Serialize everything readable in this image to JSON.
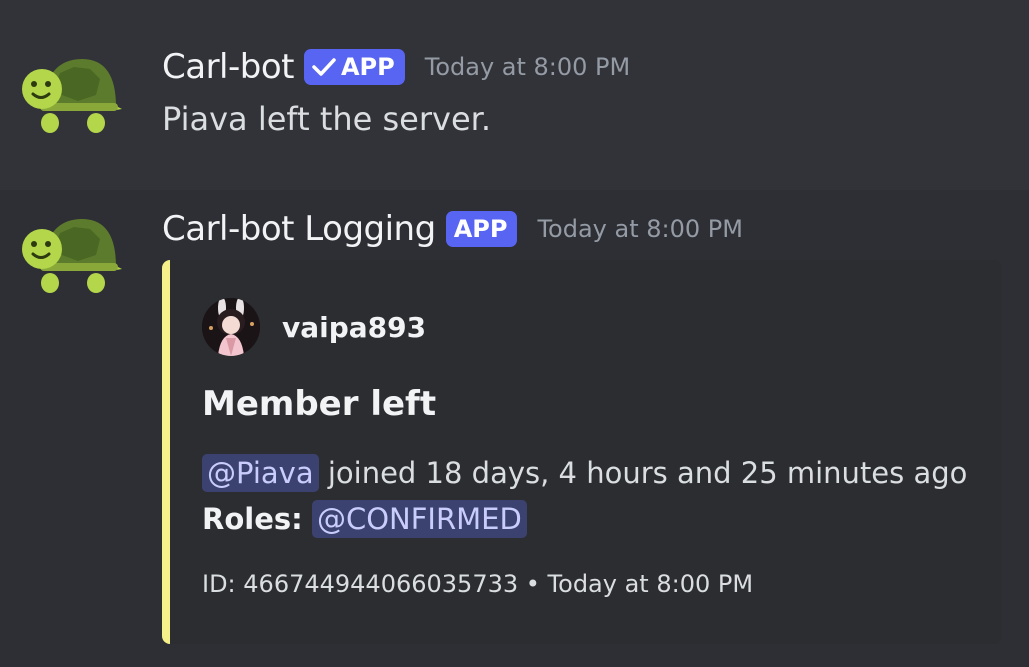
{
  "messages": [
    {
      "author": "Carl-bot",
      "badge": "APP",
      "verified": true,
      "timestamp": "Today at 8:00 PM",
      "content": "Piava left the server.",
      "avatar_icon": "turtle-icon"
    },
    {
      "author": "Carl-bot Logging",
      "badge": "APP",
      "verified": false,
      "timestamp": "Today at 8:00 PM",
      "avatar_icon": "turtle-icon",
      "embed": {
        "accent_color": "#f5f08a",
        "author_name": "vaipa893",
        "title": "Member left",
        "mention": "@Piava",
        "description_text": " joined 18 days, 4 hours and 25 minutes ago",
        "roles_label": "Roles:",
        "role_mention": "@CONFIRMED",
        "footer_id": "ID: 466744944066035733",
        "footer_separator": " • ",
        "footer_time": "Today at 8:00 PM"
      }
    }
  ],
  "colors": {
    "background": "#323339",
    "badge": "#5865f2",
    "mention_bg": "#3c4270",
    "mention_text": "#c9cdfb",
    "turtle_shell": "#5d7b2c",
    "turtle_body": "#b3d64a"
  }
}
